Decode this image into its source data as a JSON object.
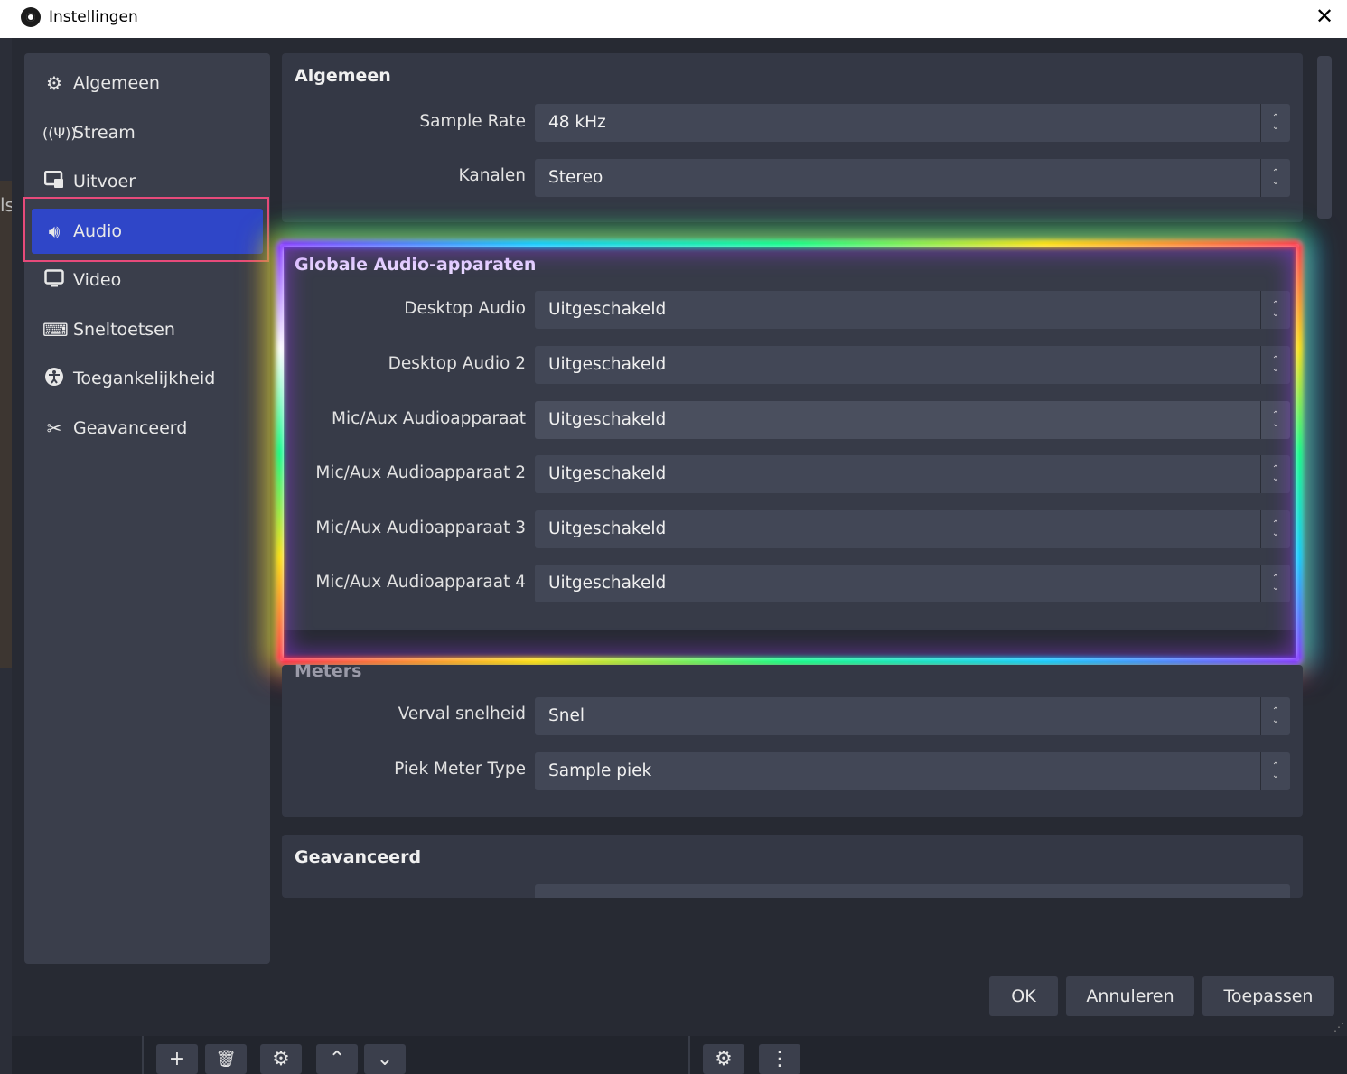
{
  "window": {
    "title": "Instellingen"
  },
  "background": {
    "peek_text": "ls"
  },
  "sidebar": {
    "items": [
      {
        "label": "Algemeen",
        "icon": "gear-icon"
      },
      {
        "label": "Stream",
        "icon": "antenna-icon"
      },
      {
        "label": "Uitvoer",
        "icon": "output-icon"
      },
      {
        "label": "Audio",
        "icon": "speaker-icon",
        "active": true
      },
      {
        "label": "Video",
        "icon": "monitor-icon"
      },
      {
        "label": "Sneltoetsen",
        "icon": "keyboard-icon"
      },
      {
        "label": "Toegankelijkheid",
        "icon": "accessibility-icon"
      },
      {
        "label": "Geavanceerd",
        "icon": "tools-icon"
      }
    ]
  },
  "groups": {
    "general": {
      "title": "Algemeen",
      "rows": [
        {
          "label": "Sample Rate",
          "value": "48 kHz"
        },
        {
          "label": "Kanalen",
          "value": "Stereo"
        }
      ]
    },
    "global_audio": {
      "title": "Globale Audio-apparaten",
      "rows": [
        {
          "label": "Desktop Audio",
          "value": "Uitgeschakeld"
        },
        {
          "label": "Desktop Audio 2",
          "value": "Uitgeschakeld"
        },
        {
          "label": "Mic/Aux Audioapparaat",
          "value": "Uitgeschakeld"
        },
        {
          "label": "Mic/Aux Audioapparaat 2",
          "value": "Uitgeschakeld"
        },
        {
          "label": "Mic/Aux Audioapparaat 3",
          "value": "Uitgeschakeld"
        },
        {
          "label": "Mic/Aux Audioapparaat 4",
          "value": "Uitgeschakeld"
        }
      ]
    },
    "meters": {
      "title": "Meters",
      "rows": [
        {
          "label": "Verval snelheid",
          "value": "Snel"
        },
        {
          "label": "Piek Meter Type",
          "value": "Sample piek"
        }
      ]
    },
    "advanced": {
      "title": "Geavanceerd"
    }
  },
  "buttons": {
    "ok": "OK",
    "cancel": "Annuleren",
    "apply": "Toepassen"
  },
  "toolbar": {
    "add": "+",
    "remove": "🗑",
    "settings": "⚙",
    "up": "⌃",
    "down": "⌄",
    "filters": "⚙",
    "more": "⋮"
  },
  "colors": {
    "accent": "#2f46c8",
    "panel": "#343845",
    "field": "#424756"
  }
}
